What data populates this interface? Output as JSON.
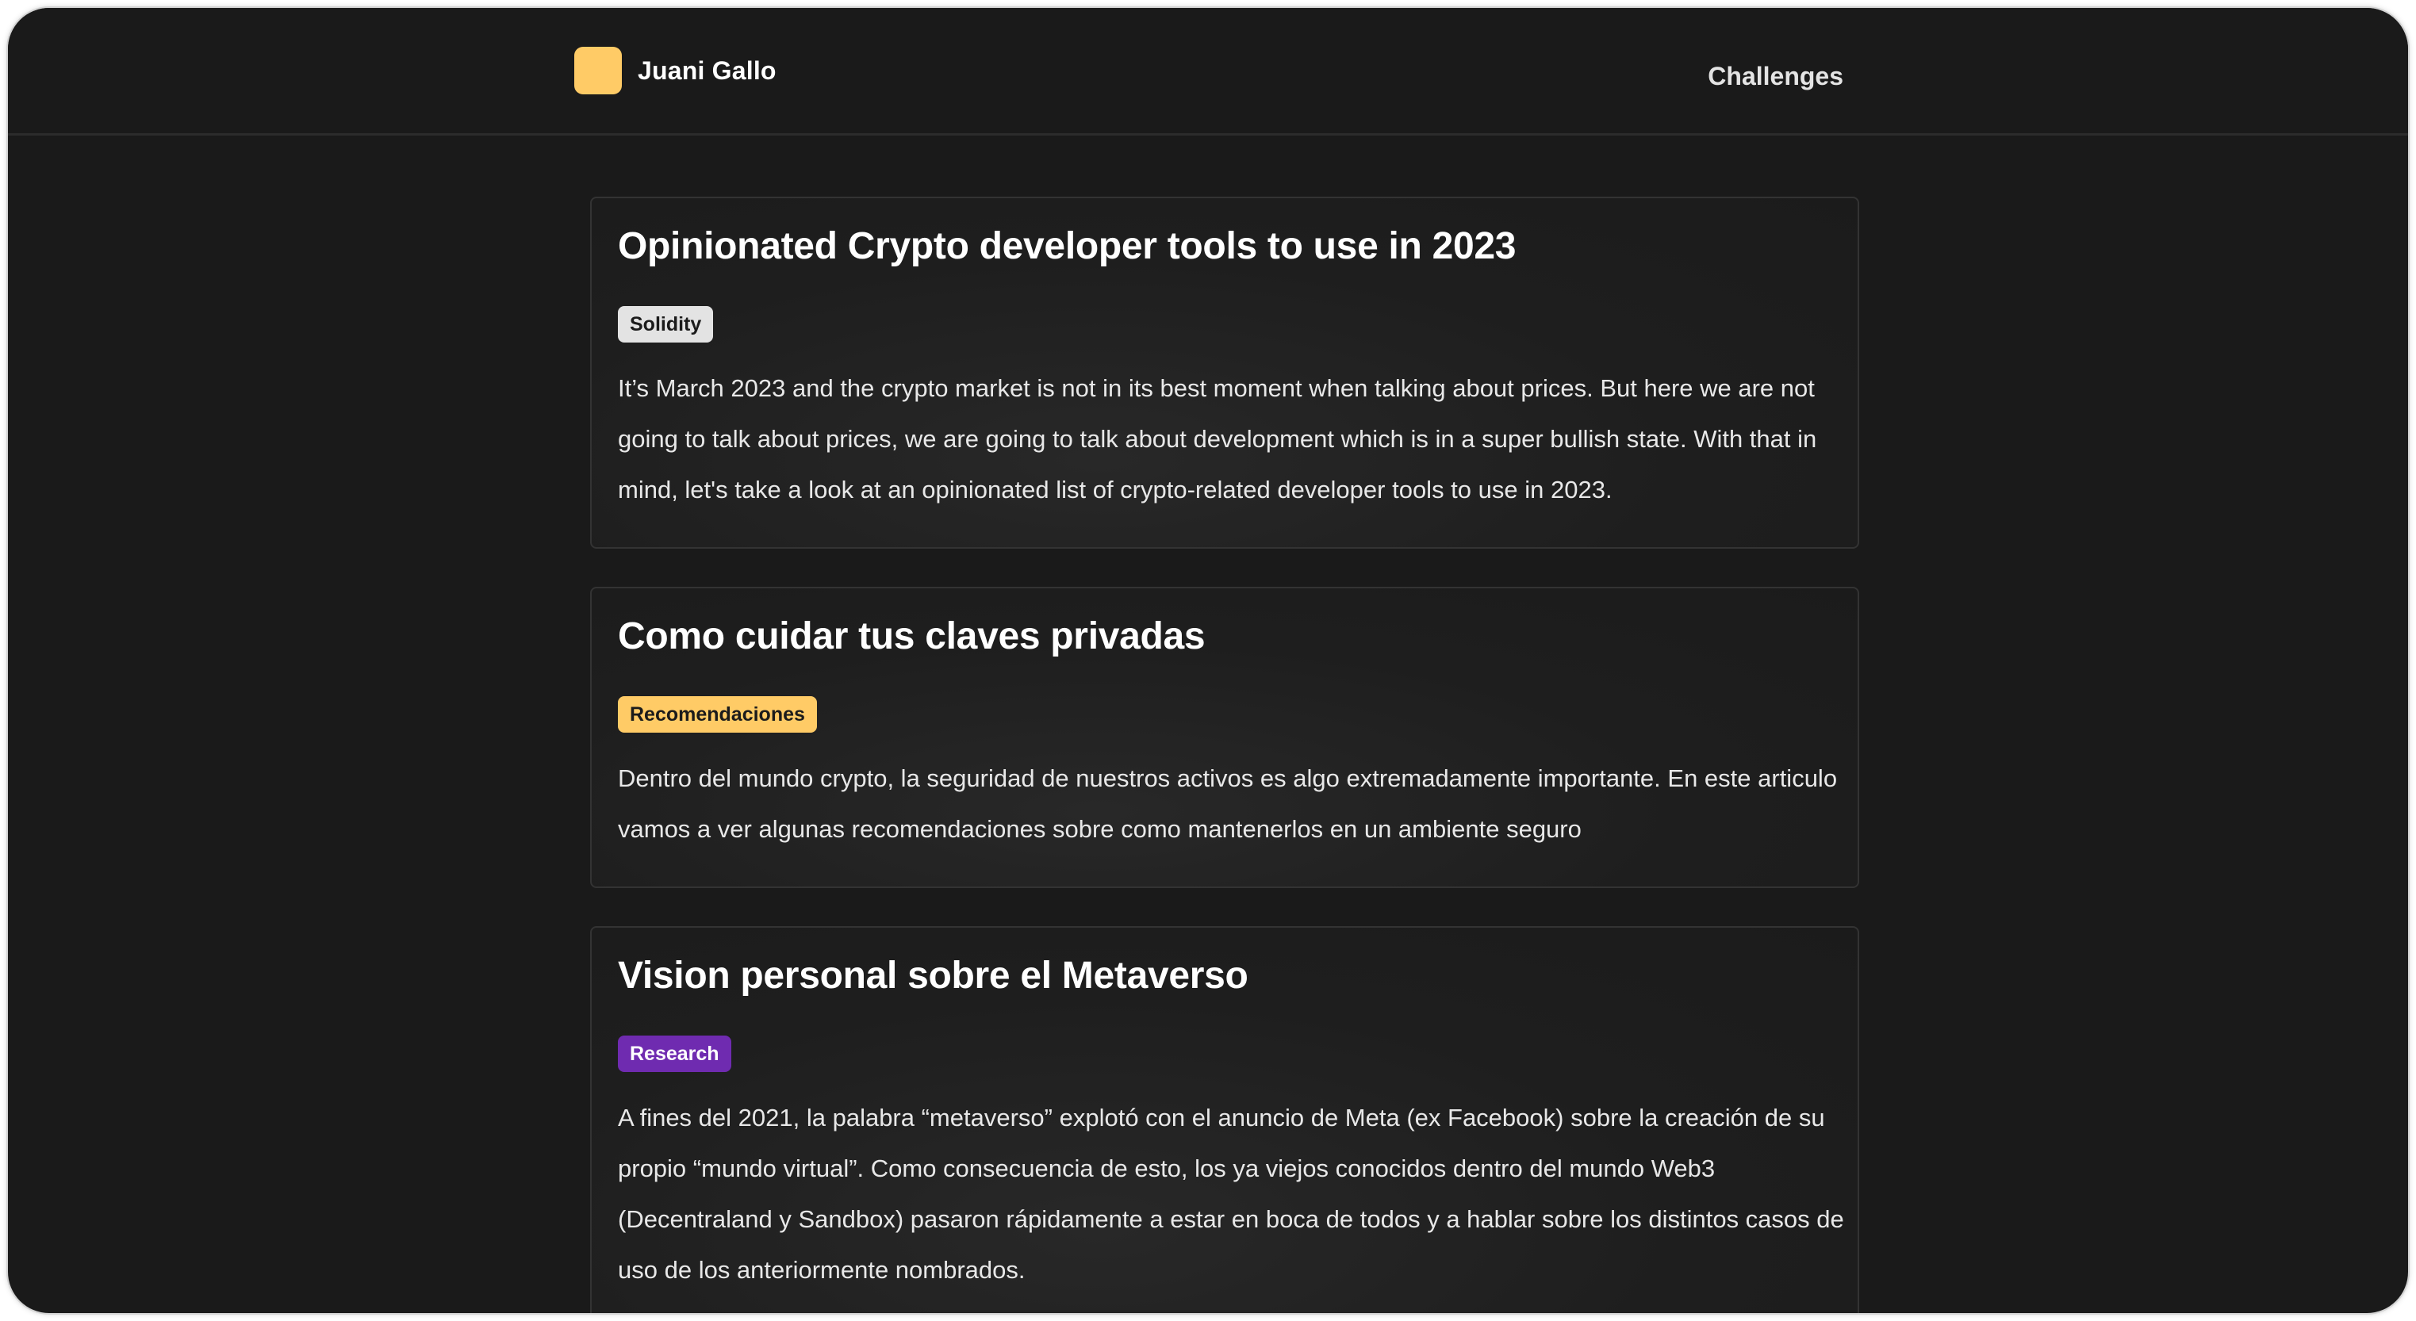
{
  "header": {
    "brand_name": "Juani Gallo",
    "nav_challenges": "Challenges"
  },
  "colors": {
    "background": "#1a1a1a",
    "brand_logo": "#ffcb66",
    "tag_solidity": "#e3e3e3",
    "tag_recomendaciones": "#ffcb66",
    "tag_research": "#6f2bb0"
  },
  "posts": [
    {
      "title": "Opinionated Crypto developer tools to use in 2023",
      "tag": "Solidity",
      "excerpt": "It’s March 2023 and the crypto market is not in its best moment when talking about prices. But here we are not going to talk about prices, we are going to talk about development which is in a super bullish state. With that in mind, let's take a look at an opinionated list of crypto-related developer tools to use in 2023."
    },
    {
      "title": "Como cuidar tus claves privadas",
      "tag": "Recomendaciones",
      "excerpt": "Dentro del mundo crypto, la seguridad de nuestros activos es algo extremadamente importante. En este articulo vamos a ver algunas recomendaciones sobre como mantenerlos en un ambiente seguro"
    },
    {
      "title": "Vision personal sobre el Metaverso",
      "tag": "Research",
      "excerpt": "A fines del 2021, la palabra “metaverso” explotó con el anuncio de Meta (ex Facebook) sobre la creación de su propio “mundo virtual”. Como consecuencia de esto, los ya viejos conocidos dentro del mundo Web3 (Decentraland y Sandbox) pasaron rápidamente a estar en boca de todos y a hablar sobre los distintos casos de uso de los anteriormente nombrados."
    }
  ]
}
